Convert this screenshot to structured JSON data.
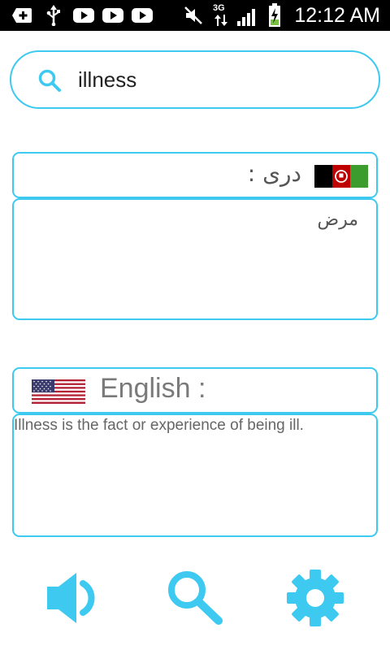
{
  "status_bar": {
    "time": "12:12 AM",
    "network": "3G",
    "icons": [
      "add-icon",
      "usb-icon",
      "youtube-icon",
      "youtube-icon",
      "youtube-icon",
      "mute-icon",
      "data-arrows-icon",
      "signal-icon",
      "battery-charging-icon"
    ]
  },
  "search": {
    "value": "illness",
    "icon": "search-icon"
  },
  "dari": {
    "label": "دری :",
    "translation": "مرض",
    "flag": "afghanistan-flag-icon"
  },
  "english": {
    "label": "English :",
    "definition": "Illness is the fact or experience of being ill.",
    "flag": "usa-flag-icon"
  },
  "actions": {
    "icons": [
      "speaker-icon",
      "search-icon",
      "settings-gear-icon"
    ]
  },
  "colors": {
    "accent": "#3ecaf0",
    "status_bar": "#000000",
    "text": "#666666"
  }
}
